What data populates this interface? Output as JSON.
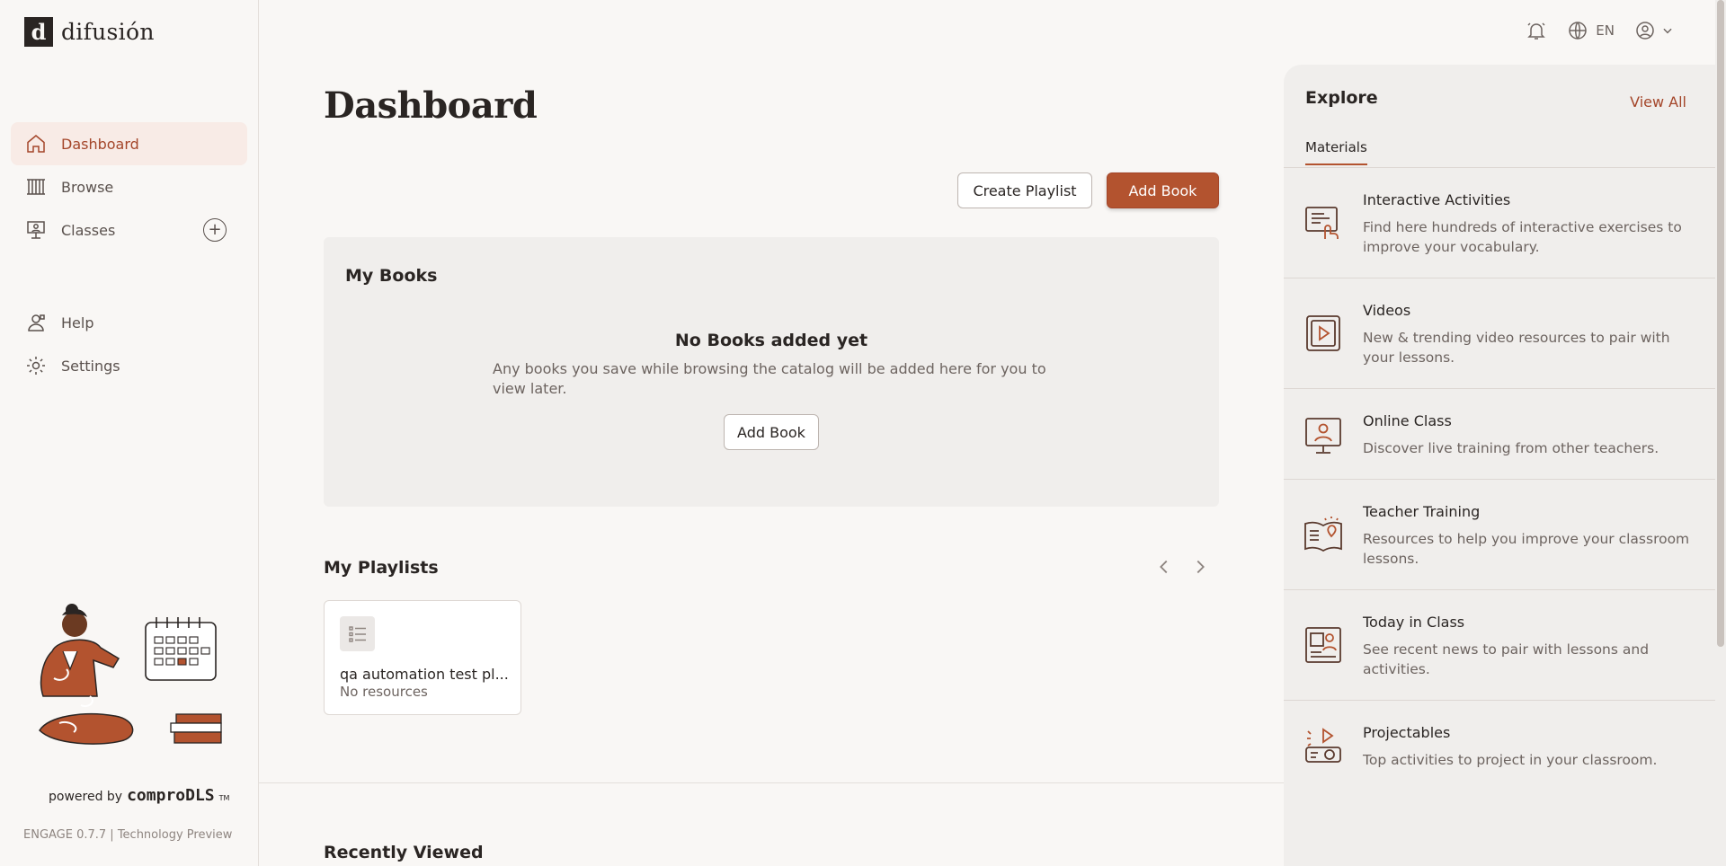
{
  "brand": {
    "logo_mark": "d",
    "name": "difusión"
  },
  "sidebar": {
    "items": [
      {
        "label": "Dashboard",
        "icon": "home-icon",
        "active": true
      },
      {
        "label": "Browse",
        "icon": "books-icon",
        "active": false
      },
      {
        "label": "Classes",
        "icon": "classroom-icon",
        "active": false
      },
      {
        "label": "Help",
        "icon": "help-icon",
        "active": false
      },
      {
        "label": "Settings",
        "icon": "gear-icon",
        "active": false
      }
    ],
    "add_class_label": "+",
    "powered_by": "powered by",
    "powered_brand": "comproDLS",
    "trademark": "TM",
    "version": "ENGAGE 0.7.7 | Technology Preview"
  },
  "topbar": {
    "language": "EN"
  },
  "main": {
    "title": "Dashboard",
    "create_playlist_label": "Create Playlist",
    "add_book_label": "Add Book",
    "my_books": {
      "title": "My Books",
      "empty_title": "No Books added yet",
      "empty_text": "Any books you save while browsing the catalog will be added here for you to view later.",
      "add_book_label": "Add Book"
    },
    "my_playlists": {
      "title": "My Playlists",
      "items": [
        {
          "name": "qa automation test pl...",
          "sub": "No resources"
        }
      ]
    },
    "recently_viewed_title": "Recently Viewed"
  },
  "explore": {
    "title": "Explore",
    "view_all": "View All",
    "tab": "Materials",
    "items": [
      {
        "title": "Interactive Activities",
        "desc": "Find here hundreds of interactive exercises to improve your vocabulary.",
        "icon": "interactive-activities-icon"
      },
      {
        "title": "Videos",
        "desc": "New & trending video resources to pair with your lessons.",
        "icon": "video-icon"
      },
      {
        "title": "Online Class",
        "desc": "Discover live training from other teachers.",
        "icon": "online-class-icon"
      },
      {
        "title": "Teacher Training",
        "desc": "Resources to help you improve your classroom lessons.",
        "icon": "teacher-training-icon"
      },
      {
        "title": "Today in Class",
        "desc": "See recent news to pair with lessons and activities.",
        "icon": "news-icon"
      },
      {
        "title": "Projectables",
        "desc": "Top activities to project in your classroom.",
        "icon": "projector-icon"
      }
    ]
  },
  "colors": {
    "accent": "#b3532f",
    "accent_text": "#a4462a",
    "active_bg": "#f8ebe6",
    "background": "#f9f7f5",
    "panel": "#f0eeec"
  }
}
